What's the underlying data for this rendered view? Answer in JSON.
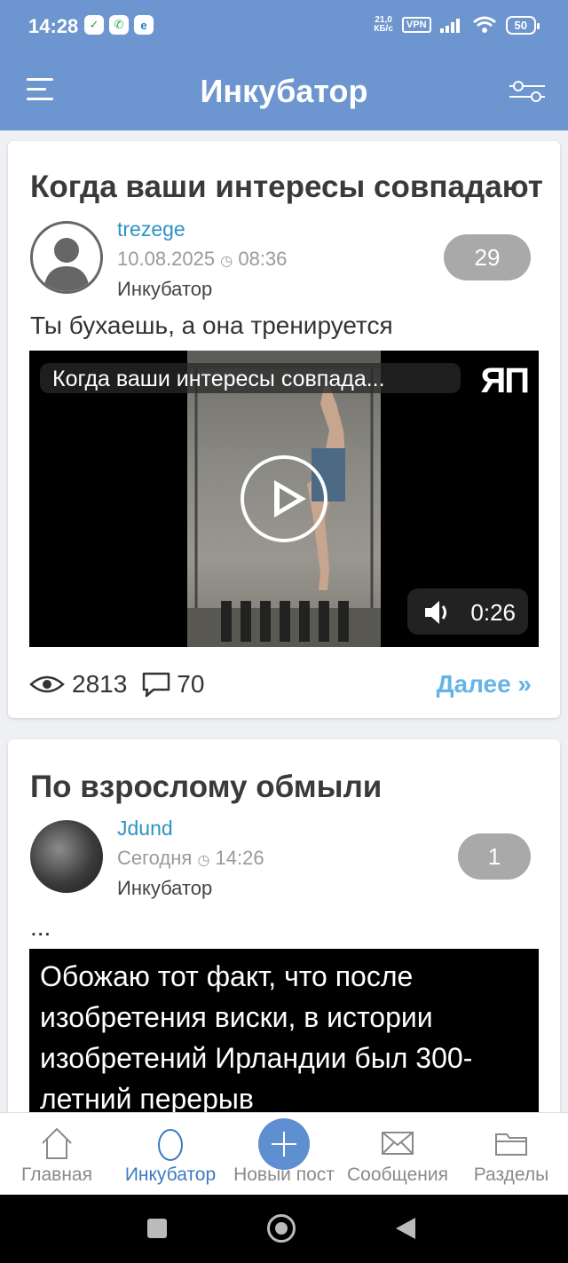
{
  "status_bar": {
    "time": "14:28",
    "speed_value": "21,0",
    "speed_unit": "КБ/с",
    "vpn": "VPN",
    "battery": "50"
  },
  "header": {
    "title": "Инкубатор"
  },
  "posts": [
    {
      "title": "Когда ваши интересы совпадают",
      "author": "trezege",
      "date": "10.08.2025",
      "time": "08:36",
      "section": "Инкубатор",
      "rating": "29",
      "text": "Ты бухаешь, а она тренируется",
      "video_title": "Когда ваши интересы совпада...",
      "video_duration": "0:26",
      "watermark": "ЯП",
      "views": "2813",
      "comments": "70",
      "more": "Далее »"
    },
    {
      "title": "По взрослому обмыли",
      "author": "Jdund",
      "date": "Сегодня",
      "time": "14:26",
      "section": "Инкубатор",
      "rating": "1",
      "text": "...",
      "image_text": "Обожаю тот факт, что после изобретения виски, в истории изобретений Ирландии был 300-летний перерыв"
    }
  ],
  "bottom_nav": [
    {
      "label": "Главная",
      "icon": "home-icon"
    },
    {
      "label": "Инкубатор",
      "icon": "egg-icon",
      "active": true
    },
    {
      "label": "Новый пост",
      "icon": "plus-icon"
    },
    {
      "label": "Сообщения",
      "icon": "envelope-icon"
    },
    {
      "label": "Разделы",
      "icon": "folder-icon"
    }
  ],
  "colors": {
    "header": "#6d95cf",
    "accent": "#3d7ac2",
    "link": "#2c93c6",
    "more_link": "#64b5e6"
  }
}
